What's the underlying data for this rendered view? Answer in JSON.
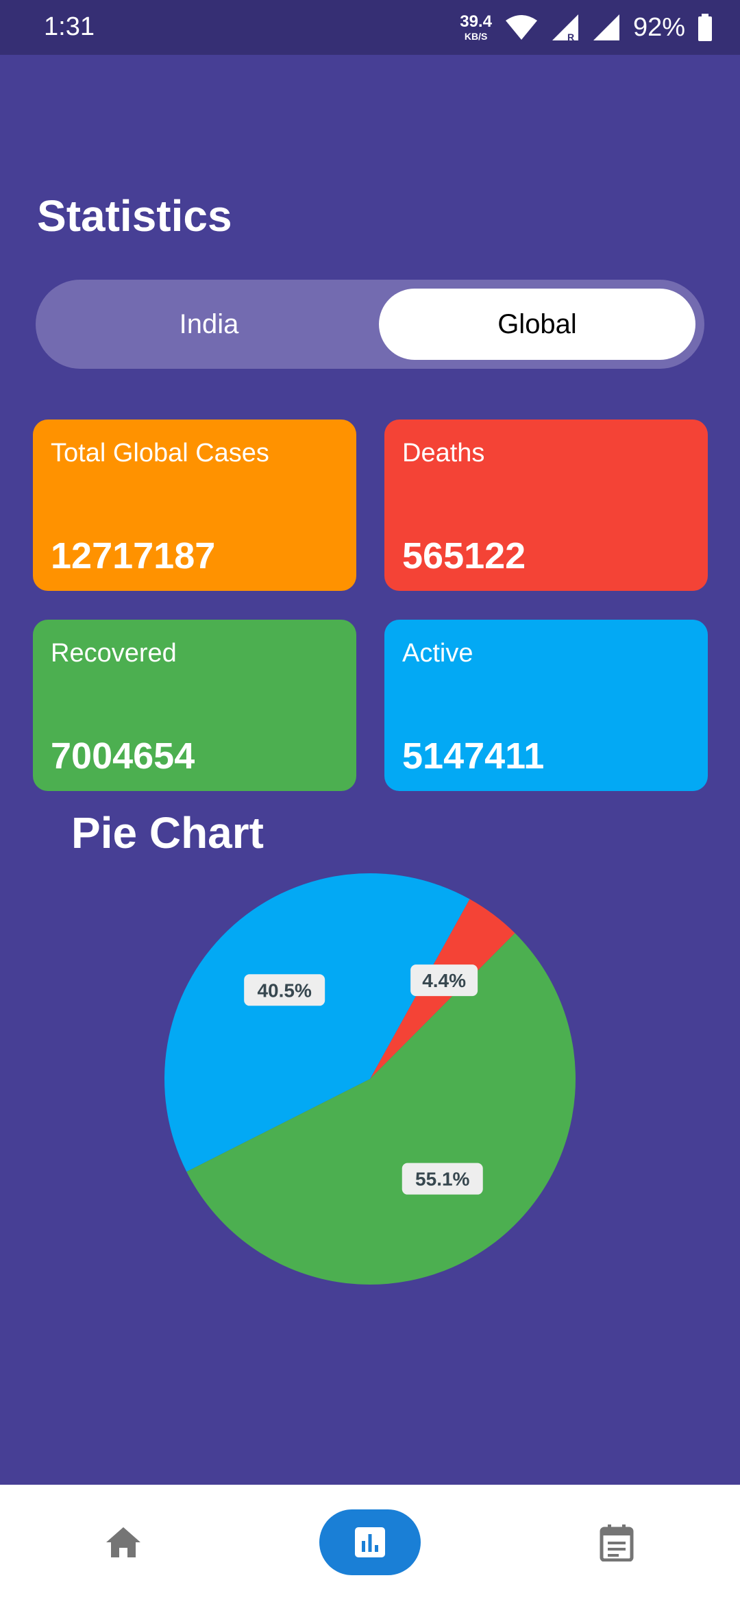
{
  "status_bar": {
    "time": "1:31",
    "net_speed_value": "39.4",
    "net_speed_unit": "KB/S",
    "battery_percent": "92%",
    "icons": [
      "wifi-icon",
      "signal-r-icon",
      "signal-icon",
      "battery-icon"
    ]
  },
  "title": "Statistics",
  "toggle": {
    "options": [
      "India",
      "Global"
    ],
    "selected": "Global"
  },
  "cards": [
    {
      "label": "Total Global Cases",
      "value": "12717187",
      "color": "#ff9200"
    },
    {
      "label": "Deaths",
      "value": "565122",
      "color": "#f44336"
    },
    {
      "label": "Recovered",
      "value": "7004654",
      "color": "#4caf50"
    },
    {
      "label": "Active",
      "value": "5147411",
      "color": "#03a9f4"
    }
  ],
  "pie_title": "Pie Chart",
  "chart_data": {
    "type": "pie",
    "start_angle_deg": -61,
    "slices": [
      {
        "value": 4.4,
        "label": "4.4%",
        "color": "#f44336"
      },
      {
        "value": 55.1,
        "label": "55.1%",
        "color": "#4caf50"
      },
      {
        "value": 40.5,
        "label": "40.5%",
        "color": "#03a9f4"
      }
    ]
  },
  "bottom_nav": {
    "items": [
      {
        "icon": "home-icon",
        "selected": false
      },
      {
        "icon": "bar-chart-icon",
        "selected": true
      },
      {
        "icon": "news-icon",
        "selected": false
      }
    ],
    "active_color": "#1a7fd6",
    "inactive_color": "#757575"
  }
}
